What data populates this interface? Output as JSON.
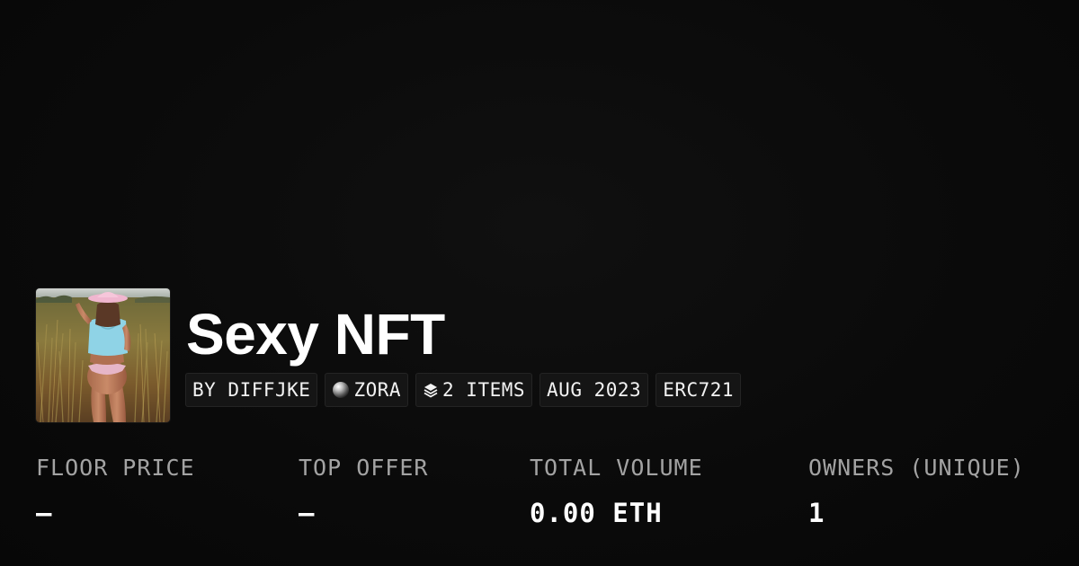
{
  "collection": {
    "title": "Sexy NFT",
    "image_alt": "painting of a woman in a pink hat and blue shirt standing in a wheat field"
  },
  "badges": {
    "creator": "BY DIFFJKE",
    "chain": "ZORA",
    "items": "2 ITEMS",
    "date": "AUG 2023",
    "standard": "ERC721"
  },
  "stats": {
    "floor_price": {
      "label": "FLOOR PRICE",
      "value": "–"
    },
    "top_offer": {
      "label": "TOP OFFER",
      "value": "–"
    },
    "total_volume": {
      "label": "TOTAL VOLUME",
      "value": "0.00 ETH"
    },
    "owners": {
      "label": "OWNERS (UNIQUE)",
      "value": "1"
    }
  },
  "colors": {
    "background": "#0a0a0a",
    "badge_bg": "#151515",
    "label": "#a3a3a3",
    "text": "#ffffff"
  },
  "icons": {
    "chain": "zora-orb-icon",
    "items": "layers-icon"
  }
}
